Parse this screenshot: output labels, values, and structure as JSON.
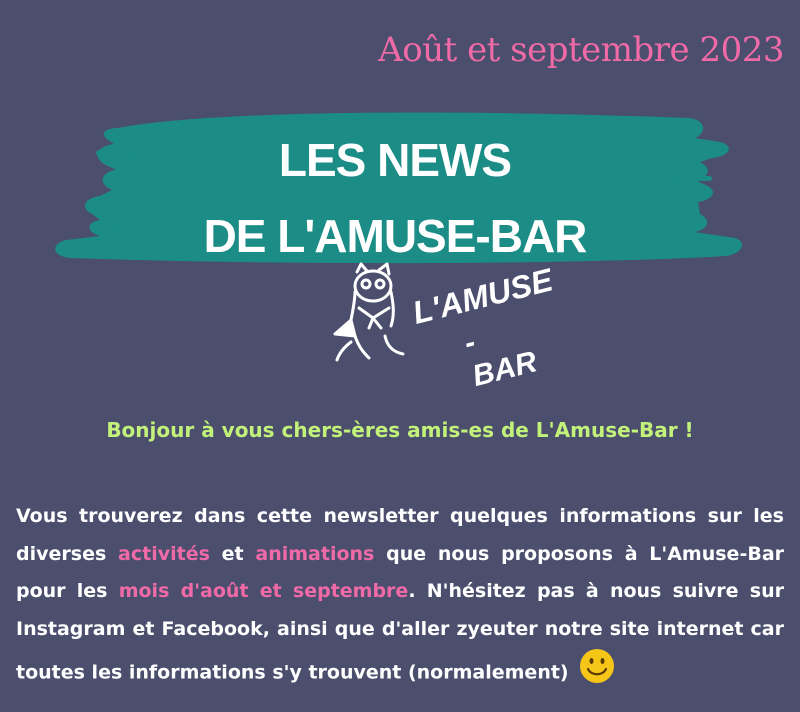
{
  "header": {
    "date": "Août et septembre 2023"
  },
  "banner": {
    "line1": "LES NEWS",
    "line2": "DE L'AMUSE-BAR",
    "color": "#1b8c86"
  },
  "logo": {
    "line1": "L'AMUSE",
    "line2": "-BAR"
  },
  "greeting": "Bonjour à vous chers-ères amis-es de L'Amuse-Bar !",
  "intro": {
    "part1": "Vous trouverez dans cette newsletter quelques informations sur les diverses ",
    "highlight1": "activités",
    "part2": " et ",
    "highlight2": "animations",
    "part3": " que nous proposons à L'Amuse-Bar pour les ",
    "highlight3": "mois d'août et septembre",
    "part4": ". N'hésitez pas à nous suivre sur Instagram et Facebook, ainsi que d'aller zyeuter notre site internet car toutes les informations s'y trouvent (normalement)"
  },
  "icons": {
    "smiley": "smiley-face-icon",
    "logo": "cat-mascot-icon"
  },
  "colors": {
    "background": "#4b4e6d",
    "accent_pink": "#f06aa8",
    "accent_green": "#c2f27a"
  }
}
